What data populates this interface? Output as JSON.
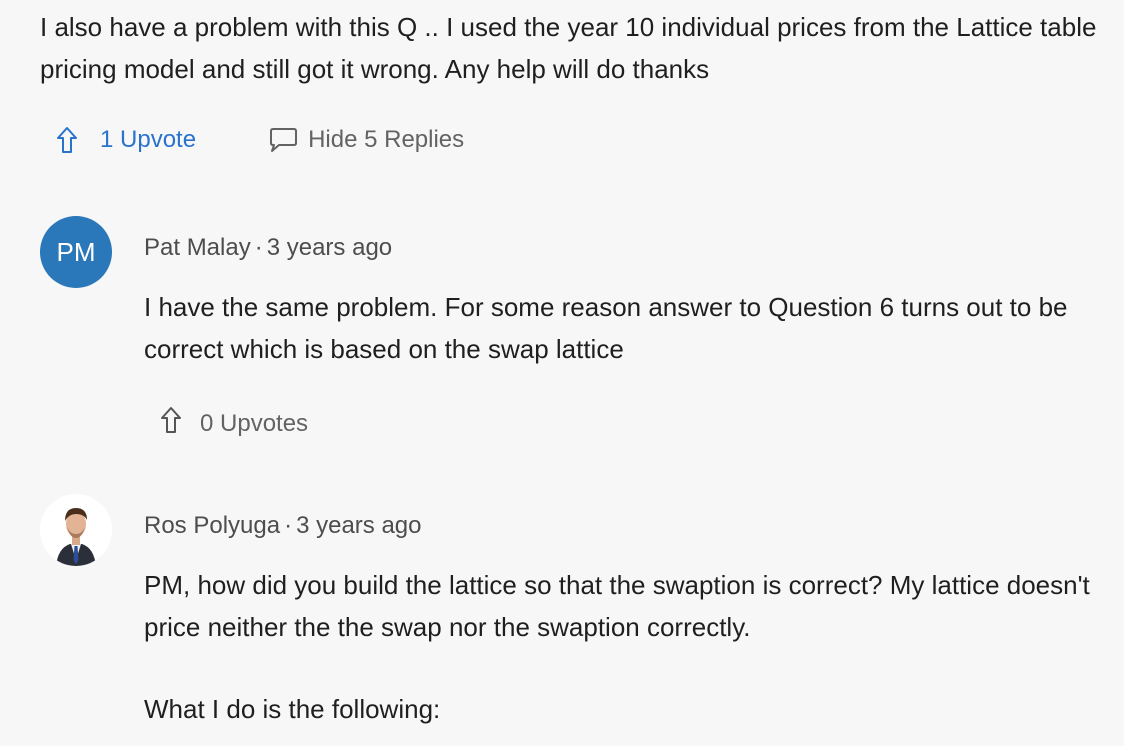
{
  "post": {
    "text": "I also have a problem with this Q .. I used the year 10 individual prices from the Lattice table pricing model and still got it wrong. Any help will do thanks",
    "upvote_label": "1 Upvote",
    "replies_label": "Hide 5 Replies"
  },
  "replies": [
    {
      "initials": "PM",
      "author": "Pat Malay",
      "separator": "·",
      "time": "3 years ago",
      "body": "I have the same problem. For some reason answer to Question 6 turns out to be correct which is based on the swap lattice",
      "upvote_label": "0 Upvotes"
    },
    {
      "author": "Ros Polyuga",
      "separator": "·",
      "time": "3 years ago",
      "body_p1": "PM, how did you build the lattice so that the swaption is correct? My lattice doesn't price neither the the swap nor the swaption correctly.",
      "body_p2": "What I do is the following:"
    }
  ],
  "colors": {
    "background": "#f7f7f7",
    "link_blue": "#2a73cc",
    "avatar_blue": "#2a77b9",
    "muted": "#636363"
  }
}
